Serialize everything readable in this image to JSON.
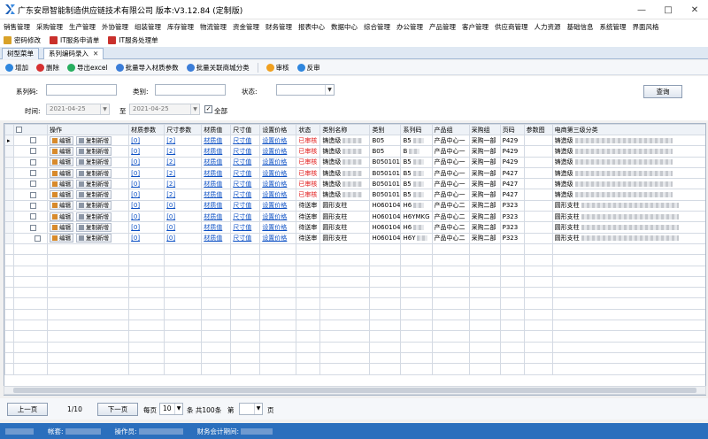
{
  "app": {
    "title": "广东安昂智能制造供应链技术有限公司 版本:V3.12.84 (定制版)"
  },
  "menu": [
    "销售管理",
    "采购管理",
    "生产管理",
    "外协管理",
    "组装管理",
    "库存管理",
    "物流管理",
    "资金管理",
    "财务管理",
    "报表中心",
    "数据中心",
    "综合管理",
    "办公管理",
    "产品管理",
    "客户管理",
    "供应商管理",
    "人力资源",
    "基础信息",
    "系统管理",
    "界面风格"
  ],
  "shortcuts": [
    {
      "label": "密码修改",
      "icon": "lock-icon",
      "color": "#d9a229"
    },
    {
      "label": "IT服务申请单",
      "icon": "form-icon",
      "color": "#c9302c"
    },
    {
      "label": "IT服务处理单",
      "icon": "form-icon",
      "color": "#c9302c"
    }
  ],
  "tabs": [
    {
      "label": "树型菜单",
      "active": false
    },
    {
      "label": "系列编码录入",
      "active": true
    }
  ],
  "toolbar": [
    {
      "label": "增加",
      "icon": "add-icon",
      "color": "#2e86de"
    },
    {
      "label": "删除",
      "icon": "delete-icon",
      "color": "#d63031"
    },
    {
      "label": "导出excel",
      "icon": "export-icon",
      "color": "#27ae60"
    },
    {
      "label": "批量导入材质参数",
      "icon": "import-icon",
      "color": "#3b7dd8"
    },
    {
      "label": "批量关联商城分类",
      "icon": "link-icon",
      "color": "#3b7dd8"
    },
    {
      "label": "审核",
      "icon": "approve-icon",
      "color": "#f0a020"
    },
    {
      "label": "反审",
      "icon": "undo-icon",
      "color": "#2e86de"
    }
  ],
  "search": {
    "series_code_label": "系列码:",
    "category_label": "类别:",
    "status_label": "状态:",
    "time_label": "时间:",
    "date_from": "2021-04-25",
    "to_label": "至",
    "date_to": "2021-04-25",
    "all_label": "全部",
    "all_checked": true,
    "query_button": "查询"
  },
  "grid": {
    "columns": [
      "",
      "",
      "操作",
      "材质参数",
      "尺寸参数",
      "材质值",
      "尺寸值",
      "设置价格",
      "状态",
      "类别名称",
      "类别",
      "系列码",
      "产品组",
      "采购组",
      "页码",
      "参数图",
      "电商第三级分类"
    ],
    "edit_label": "编辑",
    "copy_label": "复制新增",
    "rows": [
      {
        "n": "1",
        "mat": "[0]",
        "size": "[2]",
        "mat_val": "材质值",
        "size_val": "尺寸值",
        "price": "设置价格",
        "status": "已审核",
        "cat_name": "铸造级",
        "cat": "B05",
        "series": "B5",
        "pgroup": "产品中心一",
        "buy": "采购一部",
        "page": "P429",
        "img": "",
        "ecat": "铸造级"
      },
      {
        "n": "2",
        "mat": "[0]",
        "size": "[2]",
        "mat_val": "材质值",
        "size_val": "尺寸值",
        "price": "设置价格",
        "status": "已审核",
        "cat_name": "铸造级",
        "cat": "B05",
        "series": "B",
        "pgroup": "产品中心一",
        "buy": "采购一部",
        "page": "P429",
        "img": "",
        "ecat": "铸造级"
      },
      {
        "n": "3",
        "mat": "[0]",
        "size": "[2]",
        "mat_val": "材质值",
        "size_val": "尺寸值",
        "price": "设置价格",
        "status": "已审核",
        "cat_name": "铸造级",
        "cat": "B050101",
        "series": "B5",
        "pgroup": "产品中心一",
        "buy": "采购一部",
        "page": "P429",
        "img": "",
        "ecat": "铸造级"
      },
      {
        "n": "4",
        "mat": "[0]",
        "size": "[2]",
        "mat_val": "材质值",
        "size_val": "尺寸值",
        "price": "设置价格",
        "status": "已审核",
        "cat_name": "铸造级",
        "cat": "B050101",
        "series": "B5",
        "pgroup": "产品中心一",
        "buy": "采购一部",
        "page": "P427",
        "img": "",
        "ecat": "铸造级"
      },
      {
        "n": "5",
        "mat": "[0]",
        "size": "[2]",
        "mat_val": "材质值",
        "size_val": "尺寸值",
        "price": "设置价格",
        "status": "已审核",
        "cat_name": "铸造级",
        "cat": "B050101",
        "series": "B5",
        "pgroup": "产品中心一",
        "buy": "采购一部",
        "page": "P427",
        "img": "",
        "ecat": "铸造级"
      },
      {
        "n": "6",
        "mat": "[0]",
        "size": "[2]",
        "mat_val": "材质值",
        "size_val": "尺寸值",
        "price": "设置价格",
        "status": "已审核",
        "cat_name": "铸造级",
        "cat": "B050101",
        "series": "B5",
        "pgroup": "产品中心一",
        "buy": "采购一部",
        "page": "P427",
        "img": "",
        "ecat": "铸造级"
      },
      {
        "n": "7",
        "mat": "[0]",
        "size": "[0]",
        "mat_val": "材质值",
        "size_val": "尺寸值",
        "price": "设置价格",
        "status": "待送审",
        "cat_name": "圆形支柱",
        "cat": "H060104",
        "series": "H6",
        "pgroup": "产品中心二",
        "buy": "采购二部",
        "page": "P323",
        "img": "",
        "ecat": "圆形支柱"
      },
      {
        "n": "8",
        "mat": "[0]",
        "size": "[0]",
        "mat_val": "材质值",
        "size_val": "尺寸值",
        "price": "设置价格",
        "status": "待送审",
        "cat_name": "圆形支柱",
        "cat": "H060104",
        "series": "H6YMKG",
        "pgroup": "产品中心二",
        "buy": "采购二部",
        "page": "P323",
        "img": "",
        "ecat": "圆形支柱"
      },
      {
        "n": "9",
        "mat": "[0]",
        "size": "[0]",
        "mat_val": "材质值",
        "size_val": "尺寸值",
        "price": "设置价格",
        "status": "待送审",
        "cat_name": "圆形支柱",
        "cat": "H060104",
        "series": "H6",
        "pgroup": "产品中心二",
        "buy": "采购二部",
        "page": "P323",
        "img": "",
        "ecat": "圆形支柱"
      },
      {
        "n": "10",
        "mat": "[0]",
        "size": "[0]",
        "mat_val": "材质值",
        "size_val": "尺寸值",
        "price": "设置价格",
        "status": "待送审",
        "cat_name": "圆形支柱",
        "cat": "H060104",
        "series": "H6Y",
        "pgroup": "产品中心二",
        "buy": "采购二部",
        "page": "P323",
        "img": "",
        "ecat": "圆形支柱"
      }
    ]
  },
  "pager": {
    "prev": "上一页",
    "page_info": "1/10",
    "next": "下一页",
    "per_page_label": "每页",
    "per_page": "10",
    "total_label": "条 共100条",
    "goto_label": "第",
    "goto_value": "",
    "page_unit": "页"
  },
  "status": {
    "account_label": "帐套:",
    "operator_label": "操作员:",
    "period_label": "财务会计期间:"
  }
}
